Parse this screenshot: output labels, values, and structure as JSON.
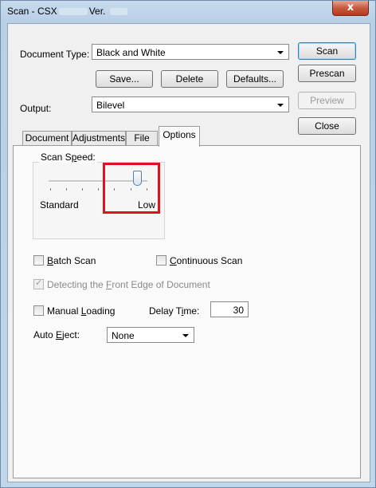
{
  "window": {
    "title_prefix": "Scan - CSX",
    "title_mid": "Ver.",
    "close_glyph": "x"
  },
  "document_type": {
    "label": "Document Type:",
    "value": "Black and White"
  },
  "buttons": {
    "scan": "Scan",
    "prescan": "Prescan",
    "preview": "Preview",
    "close": "Close",
    "save": "Save...",
    "delete": "Delete",
    "defaults": "Defaults..."
  },
  "output": {
    "label": "Output:",
    "value": "Bilevel"
  },
  "tabs": [
    {
      "label": "Document"
    },
    {
      "label": "Adjustments"
    },
    {
      "label": "File"
    },
    {
      "label": "Options"
    }
  ],
  "scan_speed": {
    "group_label_pre": "Scan S",
    "group_label_u": "p",
    "group_label_post": "eed:",
    "min_label": "Standard",
    "max_label": "Low",
    "level_fraction": 0.9
  },
  "options": {
    "batch_scan_u": "B",
    "batch_scan_rest": "atch Scan",
    "batch_scan_checked": false,
    "continuous_scan_u": "C",
    "continuous_scan_rest": "ontinuous Scan",
    "continuous_scan_checked": false,
    "front_edge_pre": "Detecting the ",
    "front_edge_u": "F",
    "front_edge_post": "ront Edge of Document",
    "front_edge_checked": true,
    "manual_loading_pre": "Manual ",
    "manual_loading_u": "L",
    "manual_loading_post": "oading",
    "manual_loading_checked": false,
    "delay_time_pre": "Delay T",
    "delay_time_u": "i",
    "delay_time_post": "me:",
    "delay_time_value": "30",
    "auto_eject_pre": "Auto ",
    "auto_eject_u": "E",
    "auto_eject_post": "ject:",
    "auto_eject_value": "None"
  }
}
